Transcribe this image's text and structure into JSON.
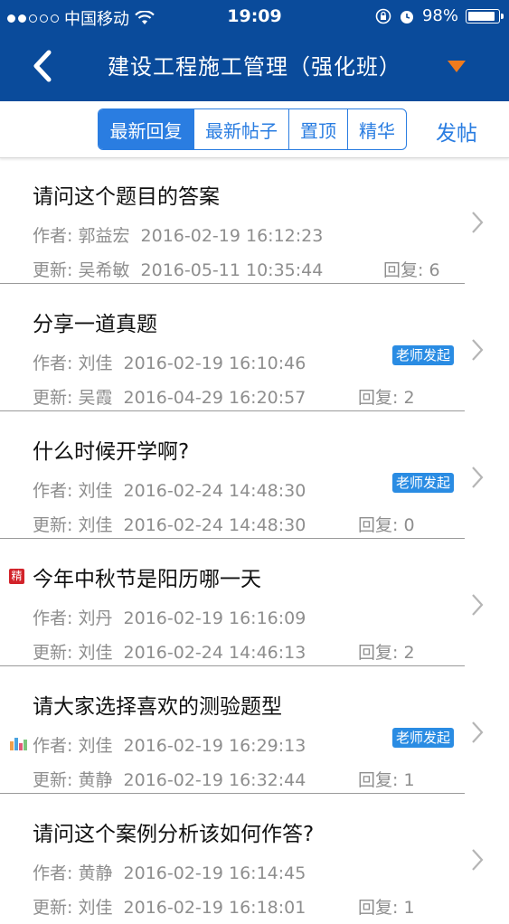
{
  "status_bar": {
    "carrier": "中国移动",
    "time": "19:09",
    "battery": "98%",
    "battery_level": 0.98
  },
  "nav": {
    "title": "建设工程施工管理（强化班）"
  },
  "tabs": [
    {
      "label": "最新回复",
      "active": true
    },
    {
      "label": "最新帖子",
      "active": false
    },
    {
      "label": "置顶",
      "active": false
    },
    {
      "label": "精华",
      "active": false
    }
  ],
  "post_button": "发帖",
  "colors": {
    "nav_bg": "#0a4b9b",
    "accent": "#2a7de1",
    "dropdown": "#f07b1d",
    "tag_bg": "#2a8ce3",
    "badge_red": "#d2232a"
  },
  "posts": [
    {
      "title": "请问这个题目的答案",
      "author": "作者: 郭益宏",
      "author_time": "2016-02-19 16:12:23",
      "updater": "更新: 吴希敏",
      "update_time": "2016-05-11 10:35:44",
      "replies": "回复: 6",
      "tag": "",
      "icon": ""
    },
    {
      "title": "分享一道真题",
      "author": "作者: 刘佳",
      "author_time": "2016-02-19 16:10:46",
      "updater": "更新: 吴霞",
      "update_time": "2016-04-29 16:20:57",
      "replies": "回复: 2",
      "tag": "老师发起",
      "icon": ""
    },
    {
      "title": "什么时候开学啊?",
      "author": "作者: 刘佳",
      "author_time": "2016-02-24 14:48:30",
      "updater": "更新: 刘佳",
      "update_time": "2016-02-24 14:48:30",
      "replies": "回复: 0",
      "tag": "老师发起",
      "icon": ""
    },
    {
      "title": "今年中秋节是阳历哪一天",
      "author": "作者: 刘丹",
      "author_time": "2016-02-19 16:16:09",
      "updater": "更新: 刘佳",
      "update_time": "2016-02-24 14:46:13",
      "replies": "回复: 2",
      "tag": "",
      "icon": "jing",
      "icon_text": "精"
    },
    {
      "title": "请大家选择喜欢的测验题型",
      "author": "作者: 刘佳",
      "author_time": "2016-02-19 16:29:13",
      "updater": "更新: 黄静",
      "update_time": "2016-02-19 16:32:44",
      "replies": "回复: 1",
      "tag": "老师发起",
      "icon": "poll-chart-icon"
    },
    {
      "title": "请问这个案例分析该如何作答?",
      "author": "作者: 黄静",
      "author_time": "2016-02-19 16:14:45",
      "updater": "更新: 刘佳",
      "update_time": "2016-02-19 16:18:01",
      "replies": "回复: 1",
      "tag": "",
      "icon": ""
    }
  ]
}
